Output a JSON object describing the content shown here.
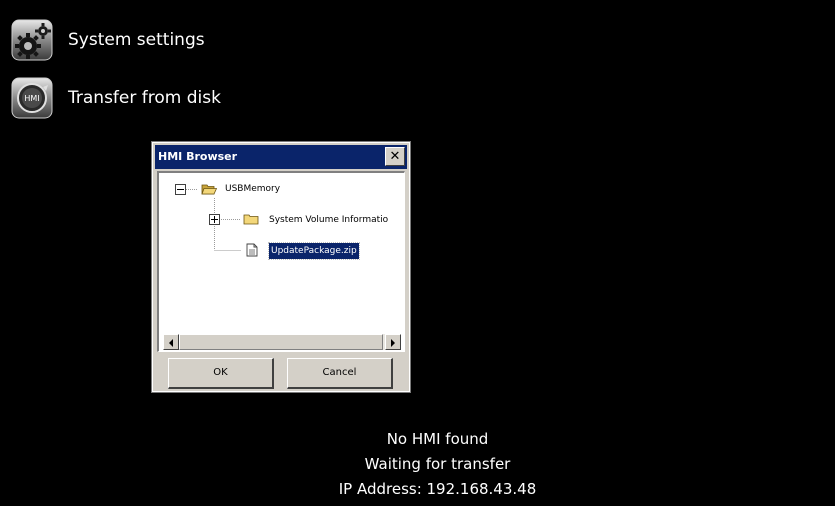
{
  "menu": {
    "items": [
      {
        "label": "System settings",
        "icon": "gear-settings-icon"
      },
      {
        "label": "Transfer from disk",
        "icon": "hmi-transfer-icon",
        "icon_text": "HMI"
      }
    ]
  },
  "dialog": {
    "title": "HMI Browser",
    "close_glyph": "✕",
    "tree": {
      "root": {
        "label": "USBMemory",
        "expanded": true
      },
      "children": [
        {
          "label": "System Volume Informatio",
          "type": "folder",
          "expandable": true
        },
        {
          "label": "UpdatePackage.zip",
          "type": "file",
          "selected": true
        }
      ]
    },
    "buttons": {
      "ok_label": "OK",
      "cancel_label": "Cancel"
    }
  },
  "status": {
    "line1": "No HMI found",
    "line2": "Waiting for transfer",
    "line3": "IP Address: 192.168.43.48"
  },
  "colors": {
    "background": "#000000",
    "titlebar": "#0a246a",
    "selection": "#0a246a",
    "dialog_face": "#d4d0c8"
  }
}
